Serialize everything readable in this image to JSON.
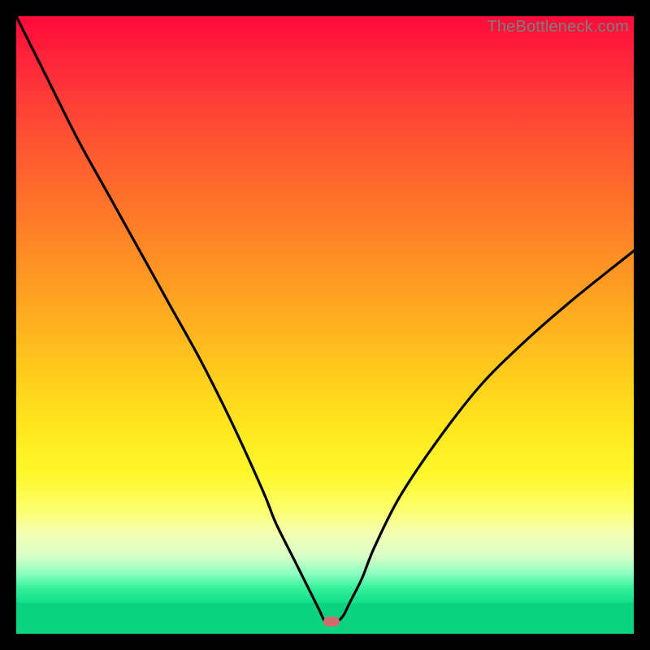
{
  "watermark": "TheBottleneck.com",
  "colors": {
    "frame": "#000000",
    "curve_stroke": "#000000",
    "dot_fill": "#d56a6d",
    "green_band": "#0bd37f"
  },
  "chart_data": {
    "type": "line",
    "title": "",
    "xlabel": "",
    "ylabel": "",
    "xlim": [
      0,
      100
    ],
    "ylim": [
      0,
      100
    ],
    "x": [
      0,
      5,
      10,
      15,
      20,
      25,
      30,
      35,
      40,
      42,
      45,
      47,
      49,
      50,
      51,
      52,
      53,
      54,
      56,
      58,
      62,
      68,
      75,
      82,
      90,
      100
    ],
    "y": [
      100,
      90,
      80,
      71,
      62,
      53,
      44,
      34,
      23,
      18,
      12,
      8,
      4,
      2,
      2,
      2,
      3,
      5,
      9,
      14,
      22,
      31,
      40,
      47,
      54,
      62
    ],
    "notch": {
      "x": 51,
      "y": 2
    },
    "background_gradient": {
      "top": "#ff0a3a",
      "mid": "#ffe61e",
      "bottom": "#0bd37f"
    }
  }
}
